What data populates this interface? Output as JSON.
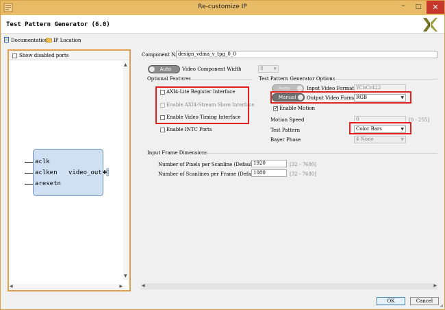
{
  "window": {
    "title": "Re-customize IP",
    "controls": {
      "minimize": "–",
      "maximize": "□",
      "close": "✕"
    }
  },
  "header": {
    "title": "Test Pattern Generator (6.0)"
  },
  "toolbar": {
    "documentation": "Documentation",
    "ip_location": "IP Location"
  },
  "left_panel": {
    "show_disabled_ports": "Show disabled ports",
    "block": {
      "inputs": [
        "aclk",
        "aclken",
        "aresetn"
      ],
      "output": "video_out"
    }
  },
  "form": {
    "component_name_label": "Component Name",
    "component_name_value": "design_vdma_v_tpg_0_0",
    "video_width_toggle": "Auto",
    "video_width_label": "Video Component Width",
    "video_width_value": "8",
    "optional_features_title": "Optional Features",
    "axi4_lite": "AXI4-Lite Register Interface",
    "axi4_stream_slave": "Enable AXI4-Stream Slave Interface",
    "video_timing": "Enable Video Timing Interface",
    "intc_ports": "Enable INTC Ports",
    "tpg_options_title": "Test Pattern Generator Options",
    "input_format_toggle": "Auto",
    "input_format_label": "Input Video Format",
    "input_format_value": "YCbCr422",
    "output_format_toggle": "Manual",
    "output_format_label": "Output Video Format",
    "output_format_value": "RGB",
    "enable_motion": "Enable Motion",
    "motion_speed_label": "Motion Speed",
    "motion_speed_value": "0",
    "motion_speed_range": "[0 - 255]",
    "test_pattern_label": "Test Pattern",
    "test_pattern_value": "Color Bars",
    "bayer_phase_label": "Bayer Phase",
    "bayer_phase_value": "4 None",
    "input_frame_title": "Input Frame Dimensions",
    "pixels_label": "Number of Pixels per Scanline (Default)",
    "pixels_value": "1920",
    "pixels_range": "[32 - 7680]",
    "scanlines_label": "Number of Scanlines per Frame (Default)",
    "scanlines_value": "1080",
    "scanlines_range": "[32 - 7680]"
  },
  "buttons": {
    "ok": "OK",
    "cancel": "Cancel"
  },
  "colors": {
    "title_bar": "#e8bb66",
    "close_button": "#c7362b",
    "highlight_box": "#e02020",
    "left_panel_border": "#e39d4f",
    "ip_block_fill": "#cfe0f2",
    "ip_block_border": "#6b8fb9"
  }
}
